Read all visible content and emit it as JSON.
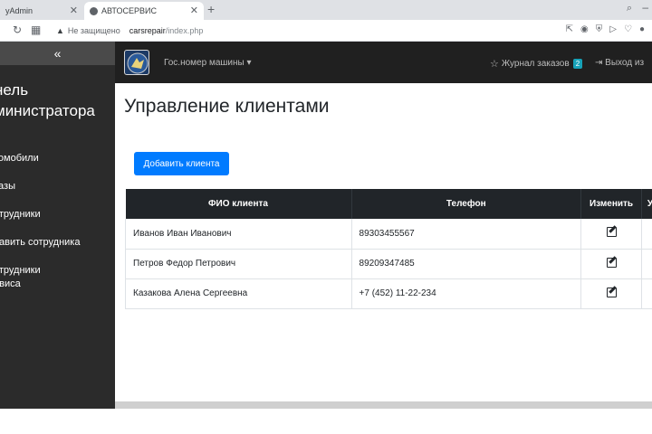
{
  "browser": {
    "tabs": [
      {
        "title": "yAdmin",
        "active": false
      },
      {
        "title": "АВТОСЕРВИС",
        "active": true
      }
    ],
    "address": {
      "security_label": "Не защищено",
      "host": "carsrepair",
      "path": "/index.php"
    }
  },
  "sidebar": {
    "collapse_symbol": "«",
    "title": "нель\nминистратора",
    "items": [
      {
        "label": "томобили"
      },
      {
        "label": "казы"
      },
      {
        "label": "отрудники"
      },
      {
        "label": "бавить сотрудника"
      },
      {
        "label": "отрудники\nрвиса"
      }
    ]
  },
  "navbar": {
    "plate_dropdown": "Гос.номер машины ▾",
    "orders_label": "Журнал заказов",
    "orders_count": "2",
    "logout_label": "Выход из"
  },
  "main": {
    "title": "Управление клиентами",
    "add_button": "Добавить клиента",
    "table": {
      "headers": [
        "ФИО клиента",
        "Телефон",
        "Изменить",
        "У"
      ],
      "rows": [
        {
          "name": "Иванов Иван Иванович",
          "phone": "89303455567"
        },
        {
          "name": "Петров Федор Петрович",
          "phone": "89209347485"
        },
        {
          "name": "Казакова Алена Сергеевна",
          "phone": "+7 (452) 11-22-234"
        }
      ]
    }
  },
  "colors": {
    "sidebar_bg": "#2b2b2b",
    "navbar_bg": "#202020",
    "primary": "#007bff",
    "table_header": "#212529",
    "badge": "#17a2b8"
  }
}
